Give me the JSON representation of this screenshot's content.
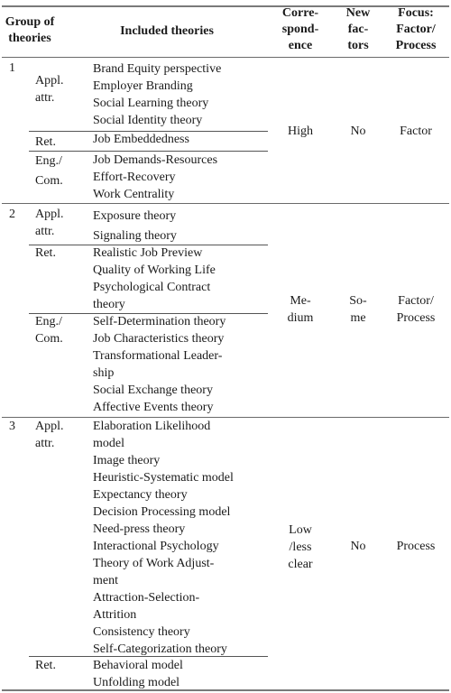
{
  "header": {
    "group": "Group of theories",
    "theories": "Included theories",
    "correspondence": "Corre-spond-ence",
    "new_factors": "New fac-tors",
    "focus": "Focus: Factor/ Process",
    "group_lines": [
      "Group of",
      "theories"
    ],
    "correspondence_lines": [
      "Corre-",
      "spond-",
      "ence"
    ],
    "new_factors_lines": [
      "New",
      "fac-",
      "tors"
    ],
    "focus_lines": [
      "Focus:",
      "Factor/",
      "Process"
    ]
  },
  "groups": [
    {
      "number": "1",
      "correspondence_lines": [
        "High"
      ],
      "new_factors_lines": [
        "No"
      ],
      "focus_lines": [
        "Factor"
      ],
      "subgroups": [
        {
          "label_lines": [
            "Appl.",
            "attr."
          ],
          "theories": [
            "Brand Equity perspective",
            "Employer Branding",
            "Social Learning theory",
            "Social Identity theory"
          ]
        },
        {
          "label_lines": [
            "Ret."
          ],
          "theories": [
            "Job Embeddedness"
          ]
        },
        {
          "label_lines": [
            "Eng./",
            "Com."
          ],
          "theories": [
            "Job Demands-Resources",
            "Effort-Recovery",
            "Work Centrality"
          ]
        }
      ]
    },
    {
      "number": "2",
      "correspondence_lines": [
        "Me-",
        "dium"
      ],
      "new_factors_lines": [
        "So-",
        "me"
      ],
      "focus_lines": [
        "Factor/",
        "Process"
      ],
      "subgroups": [
        {
          "label_lines": [
            "Appl.",
            "attr."
          ],
          "theories": [
            "Exposure theory",
            "Signaling theory"
          ]
        },
        {
          "label_lines": [
            "Ret."
          ],
          "theories": [
            "Realistic Job Preview",
            "Quality of Working Life",
            "Psychological Contract",
            "theory"
          ]
        },
        {
          "label_lines": [
            "Eng./",
            "Com."
          ],
          "theories": [
            "Self-Determination theory",
            "Job Characteristics theory",
            "Transformational Leader-",
            "ship",
            "Social Exchange theory",
            "Affective Events theory"
          ]
        }
      ]
    },
    {
      "number": "3",
      "correspondence_lines": [
        "Low",
        "/less",
        "clear"
      ],
      "new_factors_lines": [
        "No"
      ],
      "focus_lines": [
        "Process"
      ],
      "subgroups": [
        {
          "label_lines": [
            "Appl.",
            "attr."
          ],
          "theories": [
            "Elaboration Likelihood",
            "model",
            "Image theory",
            "Heuristic-Systematic model",
            "Expectancy theory",
            "Decision Processing model",
            "Need-press theory",
            "Interactional Psychology",
            "Theory of Work Adjust-",
            "ment",
            "Attraction-Selection-",
            "Attrition",
            "Consistency theory",
            "Self-Categorization theory"
          ]
        },
        {
          "label_lines": [
            "Ret."
          ],
          "theories": [
            "Behavioral model",
            "Unfolding model"
          ]
        }
      ]
    }
  ]
}
